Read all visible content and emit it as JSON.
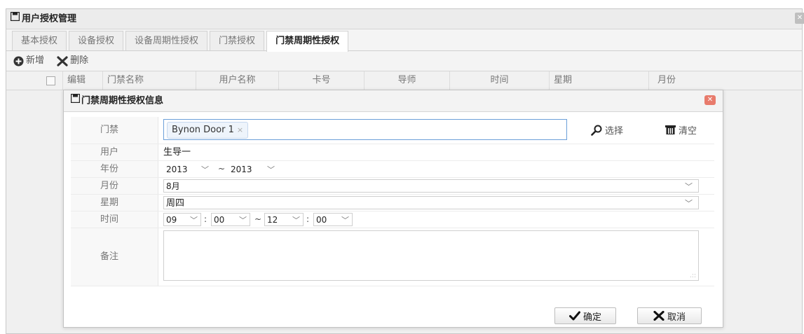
{
  "window": {
    "title": "用户授权管理",
    "icon": "floppy-icon"
  },
  "tabs": [
    {
      "label": "基本授权"
    },
    {
      "label": "设备授权"
    },
    {
      "label": "设备周期性授权"
    },
    {
      "label": "门禁授权"
    },
    {
      "label": "门禁周期性授权",
      "active": true
    }
  ],
  "toolbar": {
    "add_label": "新增",
    "delete_label": "删除"
  },
  "grid": {
    "columns": [
      "编辑",
      "门禁名称",
      "用户名称",
      "卡号",
      "导师",
      "时间",
      "星期",
      "月份"
    ]
  },
  "dialog": {
    "title": "门禁周期性授权信息",
    "door": {
      "label": "门禁",
      "tag": "Bynon Door 1",
      "tag_remove": "×",
      "select_label": "选择",
      "clear_label": "清空"
    },
    "user": {
      "label": "用户",
      "value": "生导一"
    },
    "year": {
      "label": "年份",
      "from": "2013",
      "sep": "~",
      "to": "2013"
    },
    "month": {
      "label": "月份",
      "value": "8月"
    },
    "week": {
      "label": "星期",
      "value": "周四"
    },
    "time": {
      "label": "时间",
      "from_hour": "09",
      "from_min": "00",
      "colon": ":",
      "sep": "~",
      "to_hour": "12",
      "to_min": "00"
    },
    "memo": {
      "label": "备注",
      "value": ""
    },
    "confirm_label": "确定",
    "cancel_label": "取消"
  },
  "colors": {
    "accent_border": "#6b9fd8",
    "close_red": "#e87b6c"
  }
}
